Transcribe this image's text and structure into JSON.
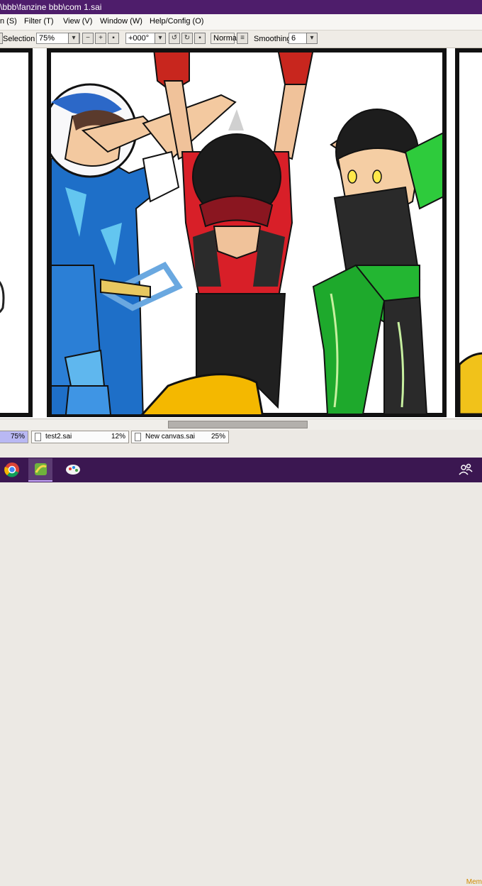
{
  "window": {
    "title": "\\bbb\\fanzine bbb\\com 1.sai"
  },
  "menu": {
    "items": [
      {
        "label": "n (S)"
      },
      {
        "label": "Filter (T)"
      },
      {
        "label": "View (V)"
      },
      {
        "label": "Window (W)"
      },
      {
        "label": "Help/Config (O)"
      }
    ]
  },
  "toolbar": {
    "selection_label": "Selection",
    "zoom_value": "75%",
    "rotation_value": "+000°",
    "blend_mode": "Normal",
    "smoothing_label": "Smoothing",
    "smoothing_value": "6"
  },
  "file_tabs": [
    {
      "name": "",
      "zoom": "75%",
      "active": true
    },
    {
      "name": "test2.sai",
      "zoom": "12%",
      "active": false
    },
    {
      "name": "New canvas.sai",
      "zoom": "25%",
      "active": false
    }
  ],
  "status": {
    "memo_text": "Mem"
  },
  "taskbar": {
    "icons": [
      "chrome-icon",
      "sai-app-icon",
      "paint-icon"
    ],
    "tray_icon": "people-icon"
  },
  "colors": {
    "titlebar": "#4e1d6b",
    "taskbar": "#3b1751",
    "active_tab": "#b9b8f3"
  }
}
